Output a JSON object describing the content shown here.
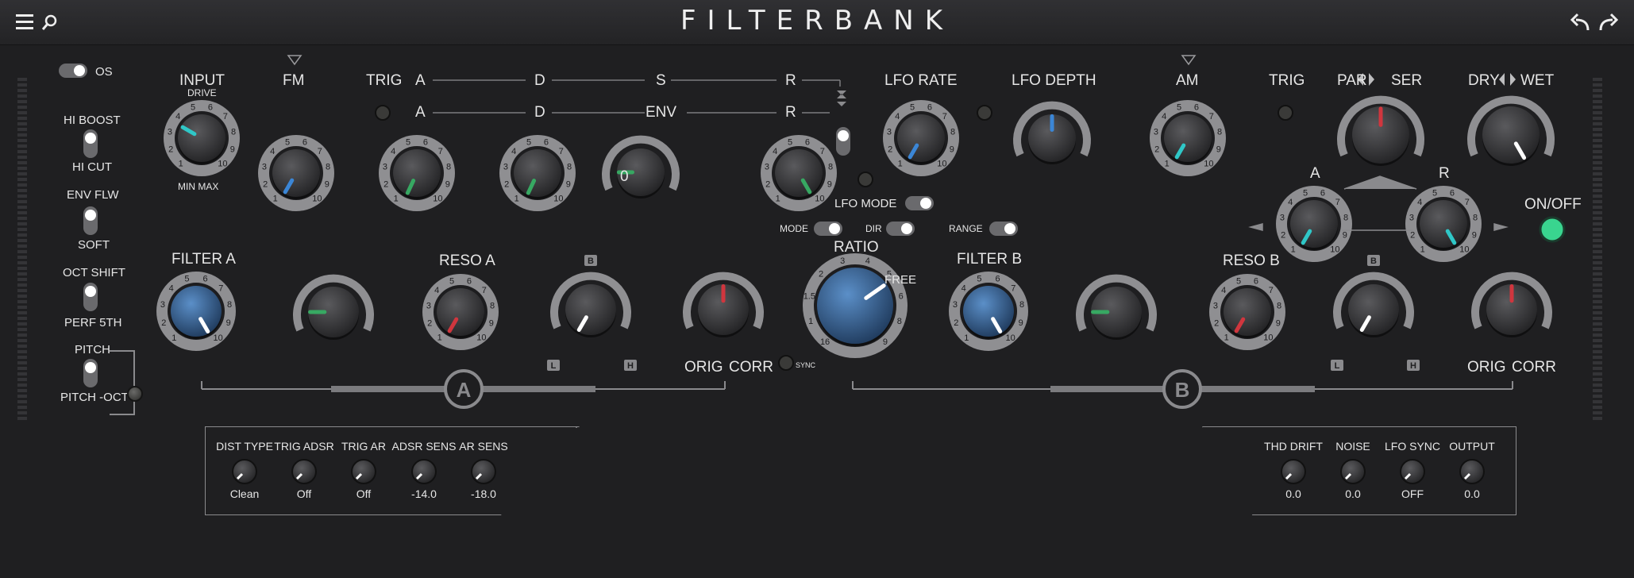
{
  "header": {
    "title": "FILTERBANK"
  },
  "left": {
    "os_label": "OS",
    "hiboost": "HI BOOST",
    "hicut": "HI CUT",
    "envflw": "ENV FLW",
    "soft": "SOFT",
    "octshift": "OCT SHIFT",
    "perf5th": "PERF 5TH",
    "pitch": "PITCH",
    "pitchoct": "PITCH -OCT"
  },
  "labels": {
    "input": "INPUT",
    "drive": "DRIVE",
    "minmax": "MIN MAX",
    "fm": "FM",
    "trig": "TRIG",
    "a": "A",
    "d": "D",
    "s": "S",
    "r": "R",
    "env": "ENV",
    "env_zero": "0",
    "plus": "+",
    "minus": "−",
    "lfo_rate": "LFO RATE",
    "lfo_depth": "LFO DEPTH",
    "am": "AM",
    "trig2": "TRIG",
    "par": "PAR",
    "ser": "SER",
    "dry": "DRY",
    "wet": "WET",
    "ar_a": "A",
    "ar_r": "R",
    "onoff": "ON/OFF",
    "lfo_mode": "LFO MODE",
    "mode": "MODE",
    "dir": "DIR",
    "range": "RANGE",
    "filter_a": "FILTER A",
    "reso_a": "RESO A",
    "ratio": "RATIO",
    "free": "FREE",
    "sync": "SYNC",
    "filter_b": "FILTER B",
    "reso_b": "RESO B",
    "orig": "ORIG",
    "corr": "CORR",
    "orig2": "ORIG",
    "corr2": "CORR",
    "b": "B",
    "l": "L",
    "h": "H",
    "b2": "B",
    "l2": "L",
    "h2": "H",
    "section_a": "A",
    "section_b": "B"
  },
  "bottom_left": [
    {
      "label": "DIST TYPE",
      "value": "Clean"
    },
    {
      "label": "TRIG ADSR",
      "value": "Off"
    },
    {
      "label": "TRIG AR",
      "value": "Off"
    },
    {
      "label": "ADSR SENS",
      "value": "-14.0"
    },
    {
      "label": "AR SENS",
      "value": "-18.0"
    }
  ],
  "bottom_right": [
    {
      "label": "THD DRIFT",
      "value": "0.0"
    },
    {
      "label": "NOISE",
      "value": "0.0"
    },
    {
      "label": "LFO SYNC",
      "value": "OFF"
    },
    {
      "label": "OUTPUT",
      "value": "0.0"
    }
  ],
  "knob_scale": [
    "1",
    "2",
    "3",
    "4",
    "5",
    "6",
    "7",
    "8",
    "9",
    "10"
  ],
  "ratio_scale": [
    "16",
    "1",
    "1.5",
    "2",
    "3",
    "4",
    "5",
    "6",
    "8",
    "9"
  ],
  "colors": {
    "teal": "#2fc7c7",
    "blue": "#3b86d6",
    "green": "#37a862",
    "red": "#d0363e",
    "white": "#ffffff",
    "led_green": "#39d58f"
  }
}
